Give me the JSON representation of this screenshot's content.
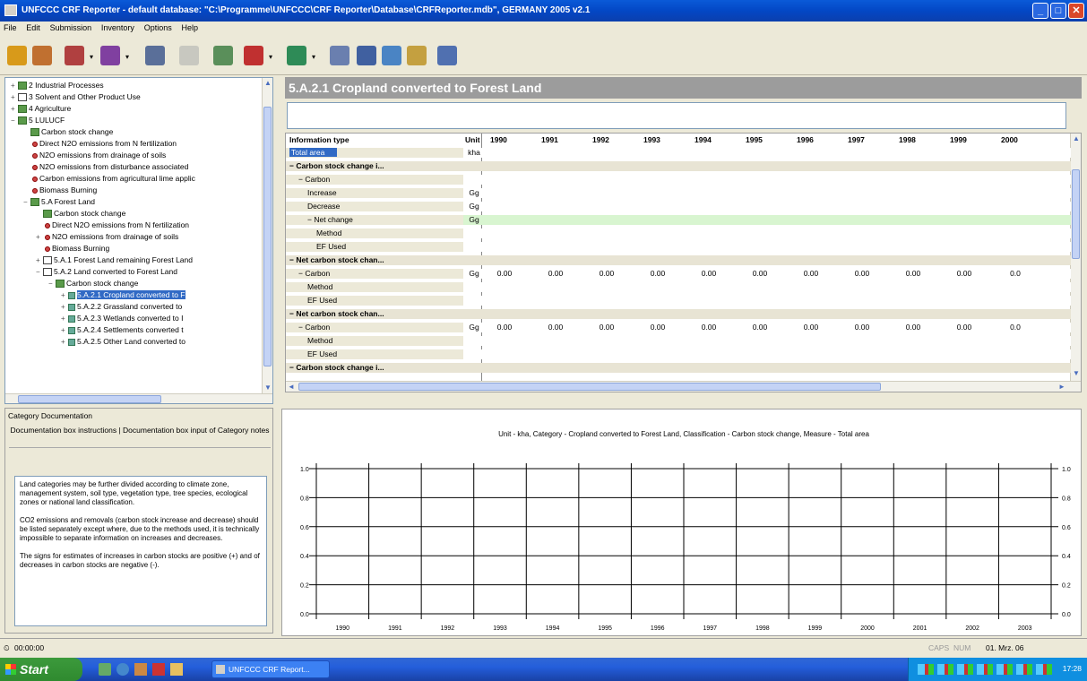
{
  "window": {
    "title": "UNFCCC CRF Reporter - default database: \"C:\\Programme\\UNFCCC\\CRF Reporter\\Database\\CRFReporter.mdb\", GERMANY 2005 v2.1",
    "buttons": {
      "minimize": "_",
      "maximize": "□",
      "close": "✕"
    }
  },
  "menu": [
    "File",
    "Edit",
    "Submission",
    "Inventory",
    "Options",
    "Help"
  ],
  "toolbar": [
    {
      "icon": "users-icon",
      "color": "#d89a1a"
    },
    {
      "icon": "user-add-icon",
      "color": "#c07030"
    },
    {
      "icon": "user-export-icon",
      "color": "#b04040",
      "dropdown": "▾"
    },
    {
      "icon": "user-import-icon",
      "color": "#8040a0",
      "dropdown": "▾"
    },
    {
      "icon": "document-icon",
      "color": "#5a6f99"
    },
    {
      "icon": "document-disabled-icon",
      "color": "#c8c8c0"
    },
    {
      "icon": "check-document-icon",
      "color": "#5a8f5a"
    },
    {
      "icon": "report-icon",
      "color": "#c03030",
      "dropdown": "▾"
    },
    {
      "icon": "chart-icon",
      "color": "#2e8b57",
      "dropdown": "▾"
    },
    {
      "icon": "calculator-icon",
      "color": "#6a7faf"
    },
    {
      "icon": "form-icon",
      "color": "#4060a0"
    },
    {
      "icon": "copy-icon",
      "color": "#4a84c4"
    },
    {
      "icon": "paste-icon",
      "color": "#c4a040"
    },
    {
      "icon": "help-book-icon",
      "color": "#5070b0"
    }
  ],
  "tree": [
    {
      "label": "2 Industrial Processes",
      "indent": 0,
      "type": "folder",
      "exp": "+"
    },
    {
      "label": "3 Solvent and Other Product Use",
      "indent": 0,
      "type": "sheet",
      "exp": "+"
    },
    {
      "label": "4 Agriculture",
      "indent": 0,
      "type": "folder",
      "exp": "+"
    },
    {
      "label": "5 LULUCF",
      "indent": 0,
      "type": "folder",
      "exp": "−"
    },
    {
      "label": "Carbon stock change",
      "indent": 1,
      "type": "folder",
      "exp": ""
    },
    {
      "label": "Direct N2O emissions from N fertilization",
      "indent": 1,
      "type": "leaf",
      "exp": ""
    },
    {
      "label": "N2O emissions from drainage of soils",
      "indent": 1,
      "type": "leaf",
      "exp": ""
    },
    {
      "label": "N2O emissions from disturbance associated",
      "indent": 1,
      "type": "leaf",
      "exp": ""
    },
    {
      "label": "Carbon emissions from agricultural lime applic",
      "indent": 1,
      "type": "leaf",
      "exp": ""
    },
    {
      "label": "Biomass Burning",
      "indent": 1,
      "type": "leaf",
      "exp": ""
    },
    {
      "label": "5.A Forest Land",
      "indent": 1,
      "type": "folder",
      "exp": "−"
    },
    {
      "label": "Carbon stock change",
      "indent": 2,
      "type": "folder",
      "exp": ""
    },
    {
      "label": "Direct N2O emissions from N fertilization",
      "indent": 2,
      "type": "leaf",
      "exp": ""
    },
    {
      "label": "N2O emissions from drainage of soils",
      "indent": 2,
      "type": "leaf",
      "exp": "+"
    },
    {
      "label": "Biomass Burning",
      "indent": 2,
      "type": "leaf",
      "exp": ""
    },
    {
      "label": "5.A.1 Forest Land remaining Forest Land",
      "indent": 2,
      "type": "sheet",
      "exp": "+"
    },
    {
      "label": "5.A.2 Land converted to Forest Land",
      "indent": 2,
      "type": "sheet",
      "exp": "−"
    },
    {
      "label": "Carbon stock change",
      "indent": 3,
      "type": "folder",
      "exp": "−"
    },
    {
      "label": "5.A.2.1 Cropland converted to F",
      "indent": 4,
      "type": "item",
      "exp": "+",
      "selected": true
    },
    {
      "label": "5.A.2.2 Grassland converted to",
      "indent": 4,
      "type": "item",
      "exp": "+"
    },
    {
      "label": "5.A.2.3 Wetlands converted to I",
      "indent": 4,
      "type": "item",
      "exp": "+"
    },
    {
      "label": "5.A.2.4 Settlements converted t",
      "indent": 4,
      "type": "item",
      "exp": "+"
    },
    {
      "label": "5.A.2.5 Other Land converted to",
      "indent": 4,
      "type": "item",
      "exp": "+"
    }
  ],
  "doc": {
    "header": "Category Documentation",
    "tab_left": "Documentation box instructions",
    "tab_right": "Documentation box input of Category notes",
    "paragraphs": [
      "Land categories may be further divided according to climate zone, management system, soil type, vegetation type, tree species, ecological zones or national land classification.",
      "CO2 emissions and removals (carbon stock increase and decrease) should be listed separately except where, due to the methods used, it is technically impossible to separate information on increases and decreases.",
      "The signs for estimates of increases in carbon stocks are positive (+) and of decreases in carbon stocks are negative (-)."
    ]
  },
  "category_title": "5.A.2.1 Cropland converted to Forest Land",
  "grid": {
    "header": {
      "info": "Information type",
      "unit": "Unit",
      "years": [
        "1990",
        "1991",
        "1992",
        "1993",
        "1994",
        "1995",
        "1996",
        "1997",
        "1998",
        "1999",
        "2000"
      ]
    },
    "rows": [
      {
        "info": "Total area",
        "unit": "kha",
        "indent": 0,
        "style": "selected",
        "values": []
      },
      {
        "info": "Carbon stock change i...",
        "unit": "",
        "indent": 0,
        "style": "group",
        "exp": "−",
        "values": []
      },
      {
        "info": "Carbon",
        "unit": "",
        "indent": 1,
        "style": "normal",
        "exp": "−",
        "values": []
      },
      {
        "info": "Increase",
        "unit": "Gg",
        "indent": 2,
        "style": "normal",
        "values": []
      },
      {
        "info": "Decrease",
        "unit": "Gg",
        "indent": 2,
        "style": "normal",
        "values": []
      },
      {
        "info": "Net change",
        "unit": "Gg",
        "indent": 2,
        "style": "green",
        "exp": "−",
        "values": []
      },
      {
        "info": "Method",
        "unit": "",
        "indent": 3,
        "style": "normal",
        "values": []
      },
      {
        "info": "EF Used",
        "unit": "",
        "indent": 3,
        "style": "normal",
        "values": []
      },
      {
        "info": "Net carbon stock chan...",
        "unit": "",
        "indent": 0,
        "style": "group",
        "exp": "−",
        "values": []
      },
      {
        "info": "Carbon",
        "unit": "Gg",
        "indent": 1,
        "style": "normal",
        "exp": "−",
        "values": [
          "0.00",
          "0.00",
          "0.00",
          "0.00",
          "0.00",
          "0.00",
          "0.00",
          "0.00",
          "0.00",
          "0.00",
          "0.0"
        ]
      },
      {
        "info": "Method",
        "unit": "",
        "indent": 2,
        "style": "normal",
        "values": []
      },
      {
        "info": "EF Used",
        "unit": "",
        "indent": 2,
        "style": "normal",
        "values": []
      },
      {
        "info": "Net carbon stock chan...",
        "unit": "",
        "indent": 0,
        "style": "group",
        "exp": "−",
        "values": []
      },
      {
        "info": "Carbon",
        "unit": "Gg",
        "indent": 1,
        "style": "normal",
        "exp": "−",
        "values": [
          "0.00",
          "0.00",
          "0.00",
          "0.00",
          "0.00",
          "0.00",
          "0.00",
          "0.00",
          "0.00",
          "0.00",
          "0.0"
        ]
      },
      {
        "info": "Method",
        "unit": "",
        "indent": 2,
        "style": "normal",
        "values": []
      },
      {
        "info": "EF Used",
        "unit": "",
        "indent": 2,
        "style": "normal",
        "values": []
      },
      {
        "info": "Carbon stock change i...",
        "unit": "",
        "indent": 0,
        "style": "group",
        "exp": "−",
        "values": []
      }
    ]
  },
  "chart_data": {
    "type": "line",
    "title": "Unit - kha, Category - Cropland converted to Forest Land, Classification - Carbon stock change, Measure - Total area",
    "categories": [
      "1990",
      "1991",
      "1992",
      "1993",
      "1994",
      "1995",
      "1996",
      "1997",
      "1998",
      "1999",
      "2000",
      "2001",
      "2002",
      "2003"
    ],
    "series": [],
    "ylim": [
      0,
      1.0
    ],
    "yticks": [
      "0.0",
      "0.2",
      "0.4",
      "0.6",
      "0.8",
      "1.0"
    ],
    "grid": true
  },
  "status": {
    "left": "00:00:00",
    "caps": "CAPS",
    "num": "NUM",
    "date": "01. Mrz. 06"
  },
  "taskbar": {
    "start": "Start",
    "task": "UNFCCC CRF Report...",
    "time": "17:28"
  }
}
